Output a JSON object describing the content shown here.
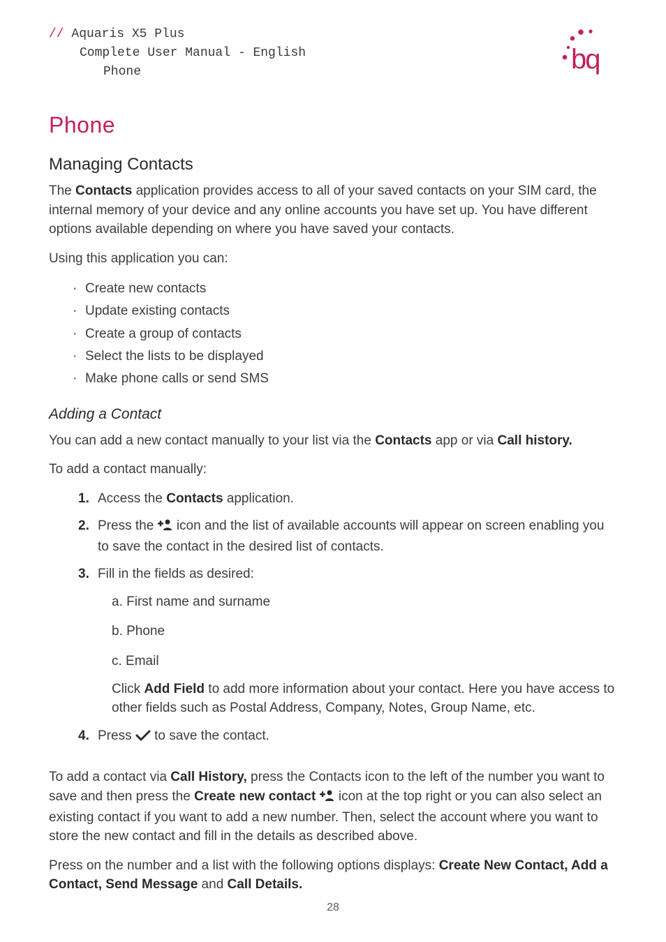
{
  "header": {
    "slashes": "//",
    "line1": "Aquaris X5 Plus",
    "line2": "Complete User Manual - English",
    "line3": "Phone"
  },
  "title": "Phone",
  "section_managing": "Managing Contacts",
  "p_intro_1a": "The ",
  "p_intro_1_strong": "Contacts",
  "p_intro_1b": " application provides access to all of your saved contacts on your SIM card, the internal memory of your device and any online accounts you have set up. You have different options available depending on where you have saved your contacts.",
  "p_intro_2": "Using this application you can:",
  "bullets": [
    "Create new contacts",
    "Update existing contacts",
    "Create a group of contacts",
    "Select the lists to be displayed",
    "Make phone calls or send SMS"
  ],
  "subsection_adding": "Adding a Contact",
  "p_add_1a": "You can add a new contact manually to your list via the ",
  "p_add_1_strong1": "Contacts",
  "p_add_1b": " app or via ",
  "p_add_1_strong2": "Call history.",
  "p_add_2": "To add a contact manually:",
  "ol": {
    "1a": "Access the ",
    "1_strong": "Contacts",
    "1b": " application.",
    "2a": "Press the ",
    "2b": " icon and the list of available accounts will appear on screen enabling you to save the contact in the desired list of contacts.",
    "3": "Fill in the fields as desired:",
    "3a": "a. First name and surname",
    "3b": "b. Phone",
    "3c": "c. Email",
    "3para_a": "Click ",
    "3para_strong": "Add Field",
    "3para_b": " to add more information about your contact. Here you have access to other fields such as Postal Address, Company, Notes, Group Name, etc.",
    "4a": "Press ",
    "4b": " to save the contact."
  },
  "p_via_1a": "To add a contact via ",
  "p_via_1_strong1": "Call History,",
  "p_via_1b": " press the Contacts icon to the left of the number you want to save and then press the ",
  "p_via_1_strong2": "Create new contact ",
  "p_via_1c": " icon at the top right or you can also select an existing contact if you want to add a new number. Then, select the account where you want to store the new contact and fill in the details as described above.",
  "p_opts_a": "Press on the number and a list with the following options displays: ",
  "p_opts_strong1": "Create New Contact, Add a Contact, Send Message",
  "p_opts_b": " and ",
  "p_opts_strong2": "Call Details.",
  "page_number": "28"
}
